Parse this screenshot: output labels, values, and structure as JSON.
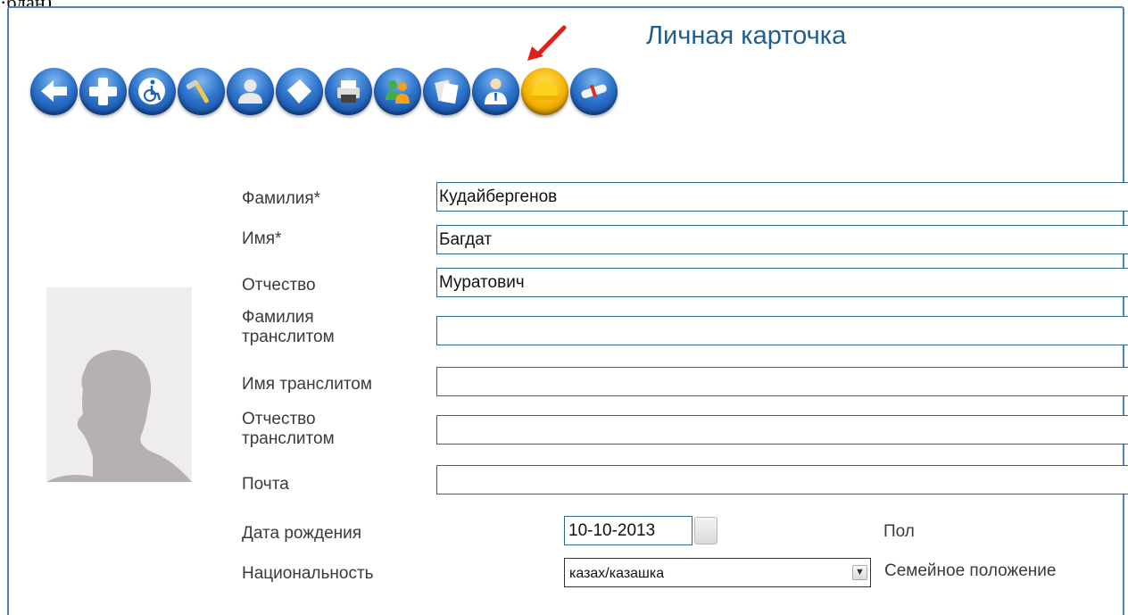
{
  "top_fragment": "·бдан)",
  "page_title": "Личная карточка",
  "toolbar": [
    {
      "icon": "back-arrow-icon"
    },
    {
      "icon": "plus-icon"
    },
    {
      "icon": "wheelchair-icon"
    },
    {
      "icon": "tools-icon"
    },
    {
      "icon": "user-icon"
    },
    {
      "icon": "tag-icon"
    },
    {
      "icon": "printer-icon"
    },
    {
      "icon": "people-icon"
    },
    {
      "icon": "documents-icon"
    },
    {
      "icon": "employee-icon"
    },
    {
      "icon": "helmet-icon"
    },
    {
      "icon": "diploma-icon"
    }
  ],
  "form": {
    "surname_label": "Фамилия*",
    "surname_value": "Кудайбергенов",
    "name_label": "Имя*",
    "name_value": "Багдат",
    "patronymic_label": "Отчество",
    "patronymic_value": "Муратович",
    "surname_translit_label_1": "Фамилия",
    "surname_translit_label_2": "транслитом",
    "surname_translit_value": "",
    "name_translit_label": "Имя транслитом",
    "name_translit_value": "",
    "patronymic_translit_label_1": "Отчество",
    "patronymic_translit_label_2": "транслитом",
    "patronymic_translit_value": "",
    "email_label": "Почта",
    "email_value": "",
    "birthdate_label": "Дата рождения",
    "birthdate_value": "10-10-2013",
    "gender_label": "Пол",
    "nationality_label": "Национальность",
    "nationality_value": "казах/казашка",
    "marital_label": "Семейное положение"
  },
  "colors": {
    "frame": "#4f81bd",
    "title": "#1f5f8f",
    "field_border": "#2e6a8e",
    "arrow": "#e0201a"
  }
}
